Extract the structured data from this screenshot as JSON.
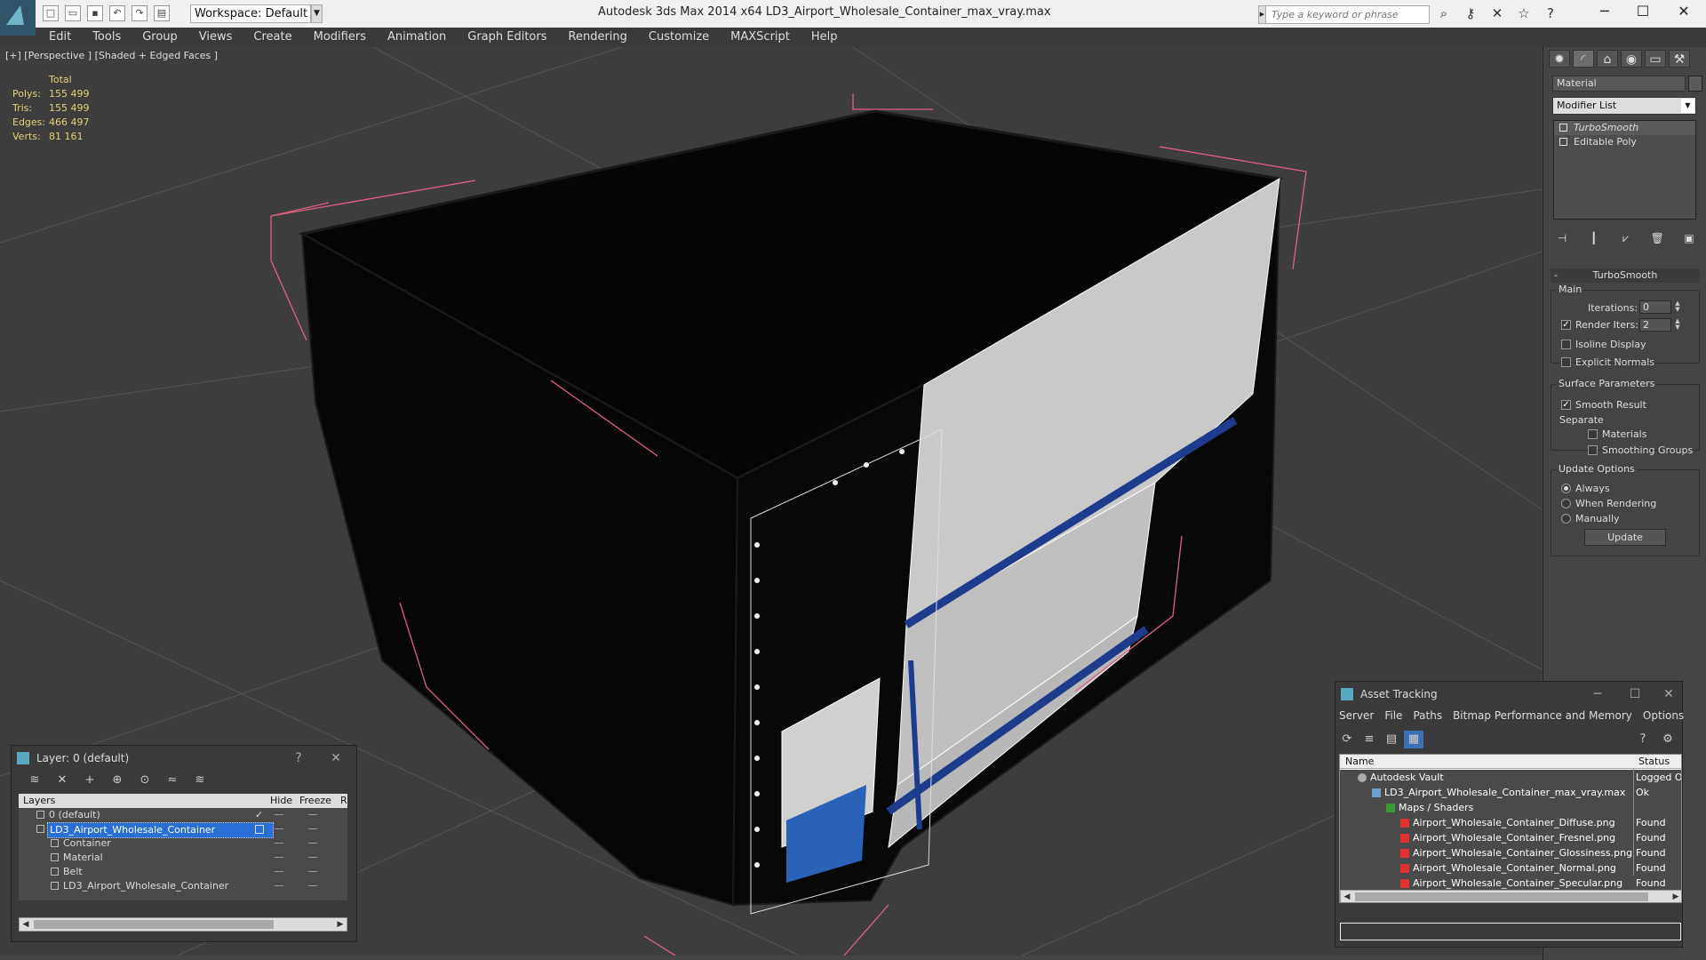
{
  "window": {
    "title": "Autodesk 3ds Max  2014 x64      LD3_Airport_Wholesale_Container_max_vray.max",
    "minimize": "─",
    "maximize": "☐",
    "close": "✕"
  },
  "toolbar": {
    "workspace": "Workspace: Default",
    "search_placeholder": "Type a keyword or phrase"
  },
  "menu": [
    "Edit",
    "Tools",
    "Group",
    "Views",
    "Create",
    "Modifiers",
    "Animation",
    "Graph Editors",
    "Rendering",
    "Customize",
    "MAXScript",
    "Help"
  ],
  "viewport": {
    "label": "[+] [Perspective ] [Shaded + Edged Faces ]",
    "stats": {
      "header": "Total",
      "polys_label": "Polys:",
      "polys": "155 499",
      "tris_label": "Tris:",
      "tris": "155 499",
      "edges_label": "Edges:",
      "edges": "466 497",
      "verts_label": "Verts:",
      "verts": "81 161"
    },
    "colors": {
      "background": "#3d3d3d",
      "selection_brackets": "#e06080",
      "strap": "#1d3c8c",
      "mesh_panel": "#c9c9c9",
      "grid": "#555555"
    }
  },
  "command_panel": {
    "name": "Material",
    "modifier_list": "Modifier List",
    "stack": [
      {
        "label": "TurboSmooth",
        "selected": true
      },
      {
        "label": "Editable Poly",
        "selected": false
      }
    ],
    "rollout": "TurboSmooth",
    "main_label": "Main",
    "iterations_label": "Iterations:",
    "iterations": "0",
    "render_iters_label": "Render Iters:",
    "render_iters": "2",
    "isoline": "Isoline Display",
    "explicit_normals": "Explicit Normals",
    "surface_params": "Surface Parameters",
    "smooth_result": "Smooth Result",
    "separate": "Separate",
    "materials": "Materials",
    "smoothing_groups": "Smoothing Groups",
    "update_options": "Update Options",
    "always": "Always",
    "when_rendering": "When Rendering",
    "manually": "Manually",
    "update_btn": "Update"
  },
  "layer_panel": {
    "title": "Layer: 0 (default)",
    "help": "?",
    "close": "✕",
    "col_layers": "Layers",
    "col_hide": "Hide",
    "col_freeze": "Freeze",
    "col_r": "R",
    "rows": [
      {
        "name": "0 (default)",
        "indent": 0,
        "selected": false
      },
      {
        "name": "LD3_Airport_Wholesale_Container",
        "indent": 0,
        "selected": true
      },
      {
        "name": "Container",
        "indent": 1,
        "selected": false
      },
      {
        "name": "Material",
        "indent": 1,
        "selected": false
      },
      {
        "name": "Belt",
        "indent": 1,
        "selected": false
      },
      {
        "name": "LD3_Airport_Wholesale_Container",
        "indent": 1,
        "selected": false
      }
    ]
  },
  "asset_tracking": {
    "title": "Asset Tracking",
    "menu": [
      "Server",
      "File",
      "Paths",
      "Bitmap Performance and Memory",
      "Options"
    ],
    "col_name": "Name",
    "col_status": "Status",
    "rows": [
      {
        "name": "Autodesk Vault",
        "status": "Logged O",
        "indent": 0
      },
      {
        "name": "LD3_Airport_Wholesale_Container_max_vray.max",
        "status": "Ok",
        "indent": 1
      },
      {
        "name": "Maps / Shaders",
        "status": "",
        "indent": 2
      },
      {
        "name": "Airport_Wholesale_Container_Diffuse.png",
        "status": "Found",
        "indent": 3
      },
      {
        "name": "Airport_Wholesale_Container_Fresnel.png",
        "status": "Found",
        "indent": 3
      },
      {
        "name": "Airport_Wholesale_Container_Glossiness.png",
        "status": "Found",
        "indent": 3
      },
      {
        "name": "Airport_Wholesale_Container_Normal.png",
        "status": "Found",
        "indent": 3
      },
      {
        "name": "Airport_Wholesale_Container_Specular.png",
        "status": "Found",
        "indent": 3
      }
    ]
  }
}
